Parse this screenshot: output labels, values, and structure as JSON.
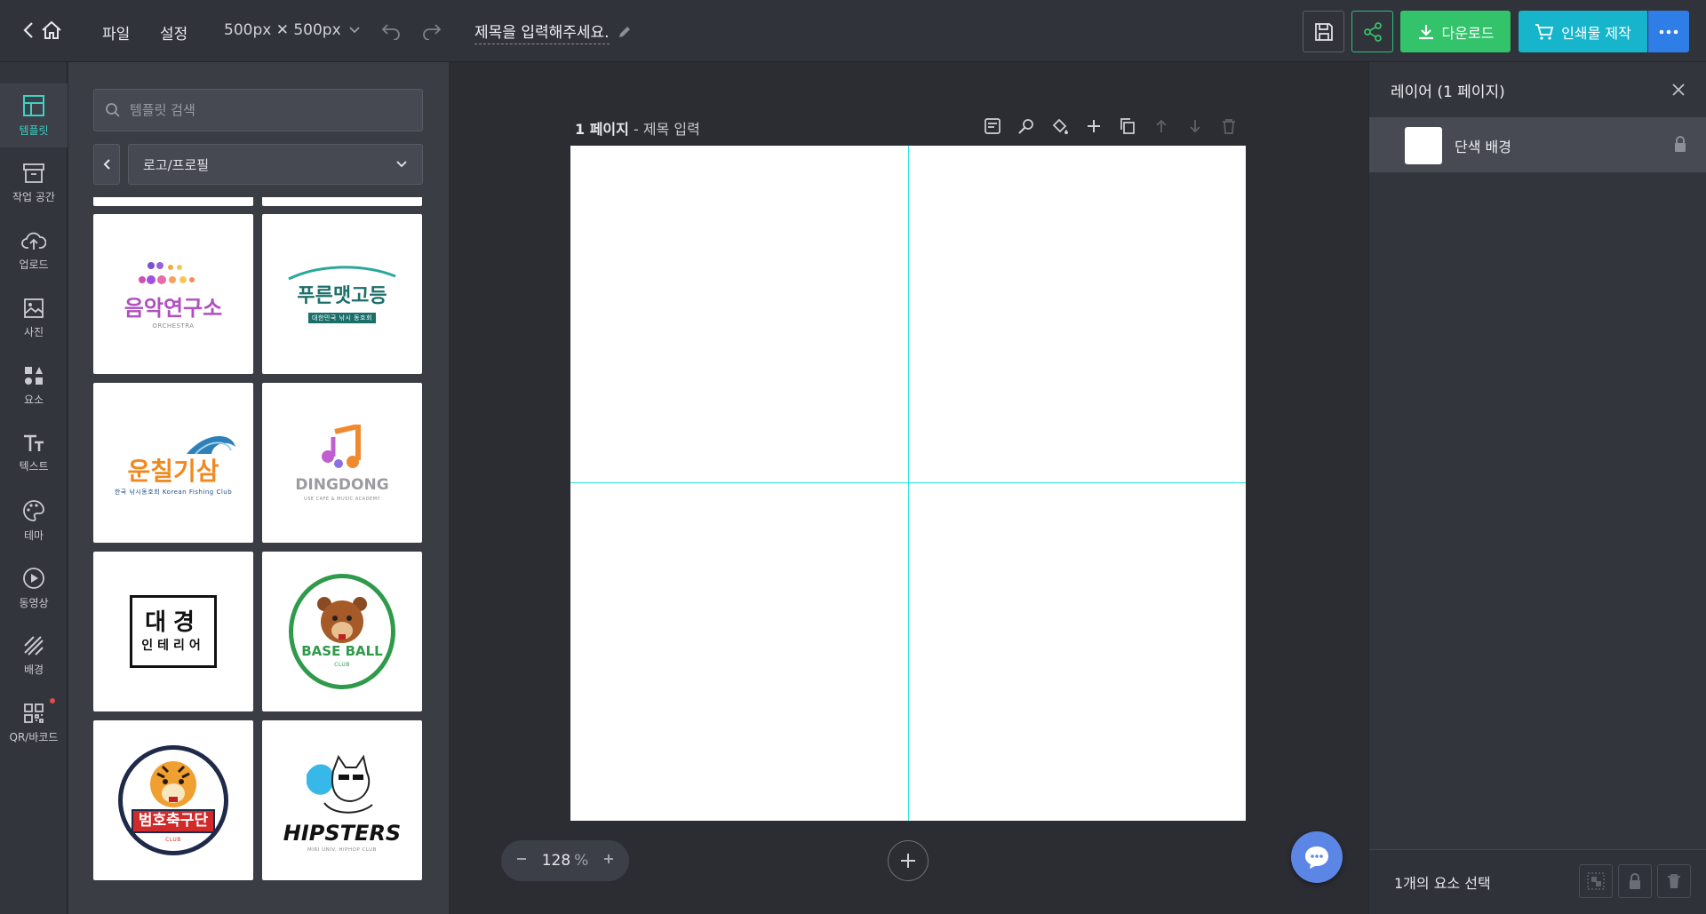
{
  "topbar": {
    "menu_file": "파일",
    "menu_settings": "설정",
    "size": "500px ✕ 500px",
    "title": "제목을 입력해주세요.",
    "download": "다운로드",
    "print": "인쇄물 제작"
  },
  "nav": [
    {
      "label": "템플릿",
      "icon": "template-icon",
      "active": true
    },
    {
      "label": "작업 공간",
      "icon": "workspace-icon"
    },
    {
      "label": "업로드",
      "icon": "upload-icon"
    },
    {
      "label": "사진",
      "icon": "photo-icon"
    },
    {
      "label": "요소",
      "icon": "elements-icon"
    },
    {
      "label": "텍스트",
      "icon": "text-icon"
    },
    {
      "label": "테마",
      "icon": "theme-icon"
    },
    {
      "label": "동영상",
      "icon": "video-icon"
    },
    {
      "label": "배경",
      "icon": "background-icon"
    },
    {
      "label": "QR/바코드",
      "icon": "qr-icon",
      "badge": true
    }
  ],
  "templates": {
    "search_placeholder": "템플릿 검색",
    "category": "로고/프로필",
    "items": [
      {
        "title": "음악연구소",
        "sub": "ORCHESTRA"
      },
      {
        "title": "푸른맷고등",
        "sub": "대한민국 낚시 동호회"
      },
      {
        "title": "운칠기삼",
        "sub": "한국 낚시동호회 Korean Fishing Club"
      },
      {
        "title": "DINGDONG",
        "sub": "USE CAFE & MUSIC ACADEMY"
      },
      {
        "title": "대경",
        "sub": "인테리어"
      },
      {
        "title": "BASE BALL",
        "sub": "CLUB"
      },
      {
        "title": "범호축구단",
        "sub": "CLUB"
      },
      {
        "title": "HIPSTERS",
        "sub": "MIRI UNIV. HIPHOP CLUB"
      }
    ]
  },
  "page": {
    "number": "1 페이지",
    "separator": " - ",
    "title": "제목 입력"
  },
  "zoom": {
    "value": "128",
    "unit": "%"
  },
  "layers": {
    "title": "레이어 (1 페이지)",
    "items": [
      {
        "name": "단색 배경"
      }
    ],
    "footer": "1개의 요소 선택"
  },
  "colors": {
    "accent": "#3dd2c4",
    "download": "#33c36a",
    "print": "#17b5cb",
    "more": "#2f7ee8",
    "guide": "#2ee6e0"
  }
}
